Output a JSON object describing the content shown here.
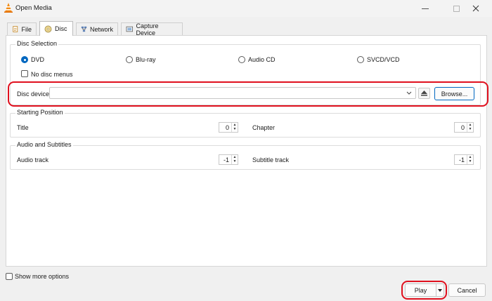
{
  "window": {
    "title": "Open Media"
  },
  "tabs": [
    {
      "label": "File",
      "icon": "file-icon"
    },
    {
      "label": "Disc",
      "icon": "disc-icon"
    },
    {
      "label": "Network",
      "icon": "network-icon"
    },
    {
      "label": "Capture Device",
      "icon": "capture-device-icon"
    }
  ],
  "active_tab": "Disc",
  "disc_selection": {
    "label": "Disc Selection",
    "options": [
      "DVD",
      "Blu-ray",
      "Audio CD",
      "SVCD/VCD"
    ],
    "selected": "DVD",
    "no_disc_menus": "No disc menus",
    "disc_device_label": "Disc device",
    "disc_device_value": "",
    "browse_label": "Browse..."
  },
  "starting_position": {
    "label": "Starting Position",
    "title_label": "Title",
    "title_value": "0",
    "chapter_label": "Chapter",
    "chapter_value": "0"
  },
  "audio_subtitles": {
    "label": "Audio and Subtitles",
    "audio_label": "Audio track",
    "audio_value": "-1",
    "subtitle_label": "Subtitle track",
    "subtitle_value": "-1"
  },
  "footer": {
    "show_more": "Show more options",
    "play_label": "Play",
    "cancel_label": "Cancel"
  },
  "colors": {
    "accent": "#0067c0",
    "highlight_ring": "#e0101e"
  }
}
